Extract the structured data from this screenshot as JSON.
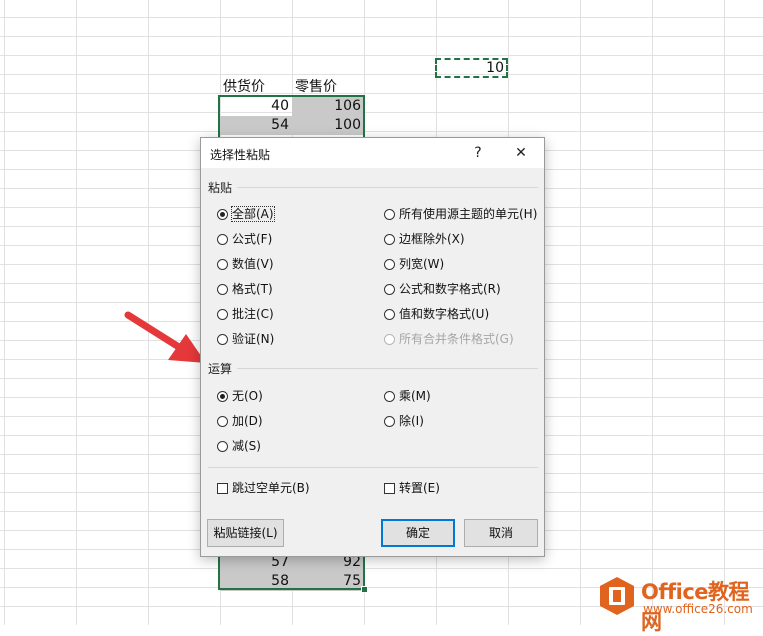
{
  "spreadsheet": {
    "headers": [
      "供货价",
      "零售价"
    ],
    "top_rows": [
      [
        "40",
        "106"
      ],
      [
        "54",
        "100"
      ]
    ],
    "bottom_rows": [
      [
        "57",
        "92"
      ],
      [
        "58",
        "75"
      ]
    ],
    "copied_cell_value": "10"
  },
  "dialog": {
    "title": "选择性粘贴",
    "help_label": "?",
    "close_label": "✕",
    "paste_section": "粘贴",
    "paste_options_left": [
      {
        "label": "全部(A)",
        "checked": true
      },
      {
        "label": "公式(F)",
        "checked": false
      },
      {
        "label": "数值(V)",
        "checked": false
      },
      {
        "label": "格式(T)",
        "checked": false
      },
      {
        "label": "批注(C)",
        "checked": false
      },
      {
        "label": "验证(N)",
        "checked": false
      }
    ],
    "paste_options_right": [
      {
        "label": "所有使用源主题的单元(H)",
        "checked": false
      },
      {
        "label": "边框除外(X)",
        "checked": false
      },
      {
        "label": "列宽(W)",
        "checked": false
      },
      {
        "label": "公式和数字格式(R)",
        "checked": false
      },
      {
        "label": "值和数字格式(U)",
        "checked": false
      },
      {
        "label": "所有合并条件格式(G)",
        "checked": false,
        "disabled": true
      }
    ],
    "operation_section": "运算",
    "operation_left": [
      {
        "label": "无(O)",
        "checked": true
      },
      {
        "label": "加(D)",
        "checked": false
      },
      {
        "label": "减(S)",
        "checked": false
      }
    ],
    "operation_right": [
      {
        "label": "乘(M)",
        "checked": false
      },
      {
        "label": "除(I)",
        "checked": false
      }
    ],
    "skip_blanks": "跳过空单元(B)",
    "transpose": "转置(E)",
    "paste_link": "粘贴链接(L)",
    "ok": "确定",
    "cancel": "取消"
  },
  "watermark": {
    "brand": "Office教程网",
    "url": "www.office26.com"
  },
  "colors": {
    "selection": "#217346",
    "arrow": "#e5383b",
    "default_button": "#0078d7",
    "logo": "#e0641e"
  }
}
